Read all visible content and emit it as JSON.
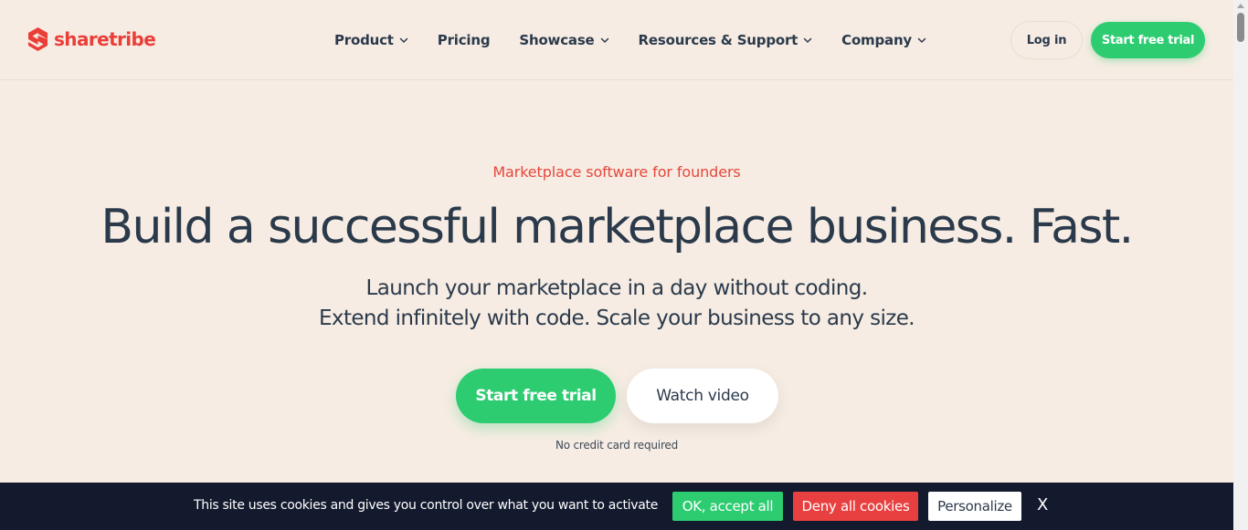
{
  "brand": {
    "name": "sharetribe",
    "color": "#ea3f39",
    "icon": "sharetribe-logo-icon"
  },
  "nav": {
    "items": [
      {
        "label": "Product",
        "has_dropdown": true
      },
      {
        "label": "Pricing",
        "has_dropdown": false
      },
      {
        "label": "Showcase",
        "has_dropdown": true
      },
      {
        "label": "Resources & Support",
        "has_dropdown": true
      },
      {
        "label": "Company",
        "has_dropdown": true
      }
    ],
    "login_label": "Log in",
    "trial_label": "Start free trial"
  },
  "hero": {
    "eyebrow": "Marketplace software for founders",
    "headline": "Build a successful marketplace business. Fast.",
    "sub_line_1": "Launch your marketplace in a day without coding.",
    "sub_line_2": "Extend infinitely with code. Scale your business to any size.",
    "primary_cta": "Start free trial",
    "secondary_cta": "Watch video",
    "note": "No credit card required"
  },
  "cookie_banner": {
    "text": "This site uses cookies and gives you control over what you want to activate",
    "accept_label": "OK, accept all",
    "deny_label": "Deny all cookies",
    "personalize_label": "Personalize",
    "close_label": "X"
  },
  "colors": {
    "background": "#f6ece3",
    "accent_green": "#2ecc71",
    "accent_red": "#e6473c",
    "text_dark": "#2b3a4b",
    "cookie_bar": "#131a2e"
  }
}
